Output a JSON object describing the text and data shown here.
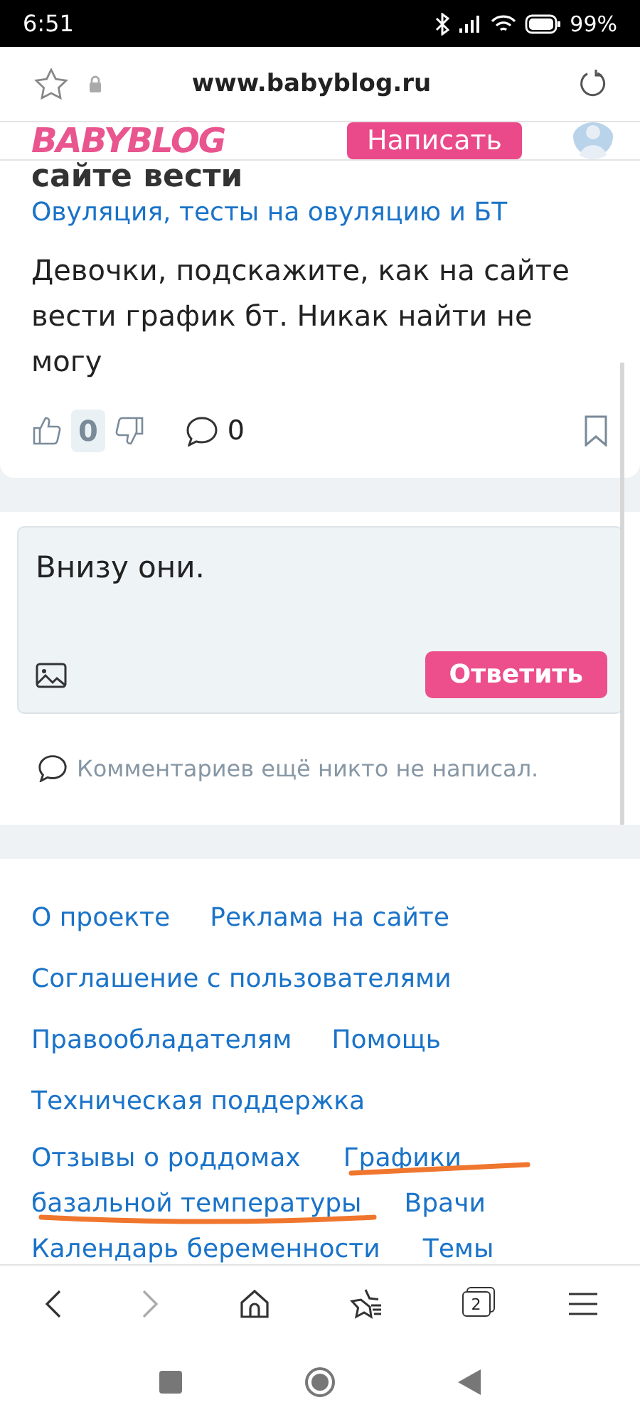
{
  "status_bar": {
    "time": "6:51",
    "battery": "99%"
  },
  "browser": {
    "url": "www.babyblog.ru"
  },
  "site_header": {
    "logo": "BABYBLOG",
    "write_button": "Написать"
  },
  "post": {
    "title_fragment": "сайте вести",
    "category": "Овуляция, тесты на овуляцию и БТ",
    "body": "Девочки, подскажите, как на сайте вести график бт. Никак найти не могу",
    "rating": "0",
    "comments_count": "0"
  },
  "reply": {
    "value": "Внизу они.",
    "button": "Ответить"
  },
  "comments_empty": "Комментариев ещё никто не написал.",
  "footer_rows": [
    [
      "О проекте",
      "Реклама на сайте"
    ],
    [
      "Соглашение с пользователями"
    ],
    [
      "Правообладателям",
      "Помощь"
    ],
    [
      "Техническая поддержка"
    ]
  ],
  "footer_flow": [
    [
      "Отзывы о роддомах",
      "Графики"
    ],
    [
      "базальной температуры",
      "Врачи"
    ],
    [
      "Календарь беременности",
      "Темы"
    ]
  ],
  "bottom_nav": {
    "back_disabled": false,
    "forward_disabled": true,
    "tab_count": "2"
  }
}
